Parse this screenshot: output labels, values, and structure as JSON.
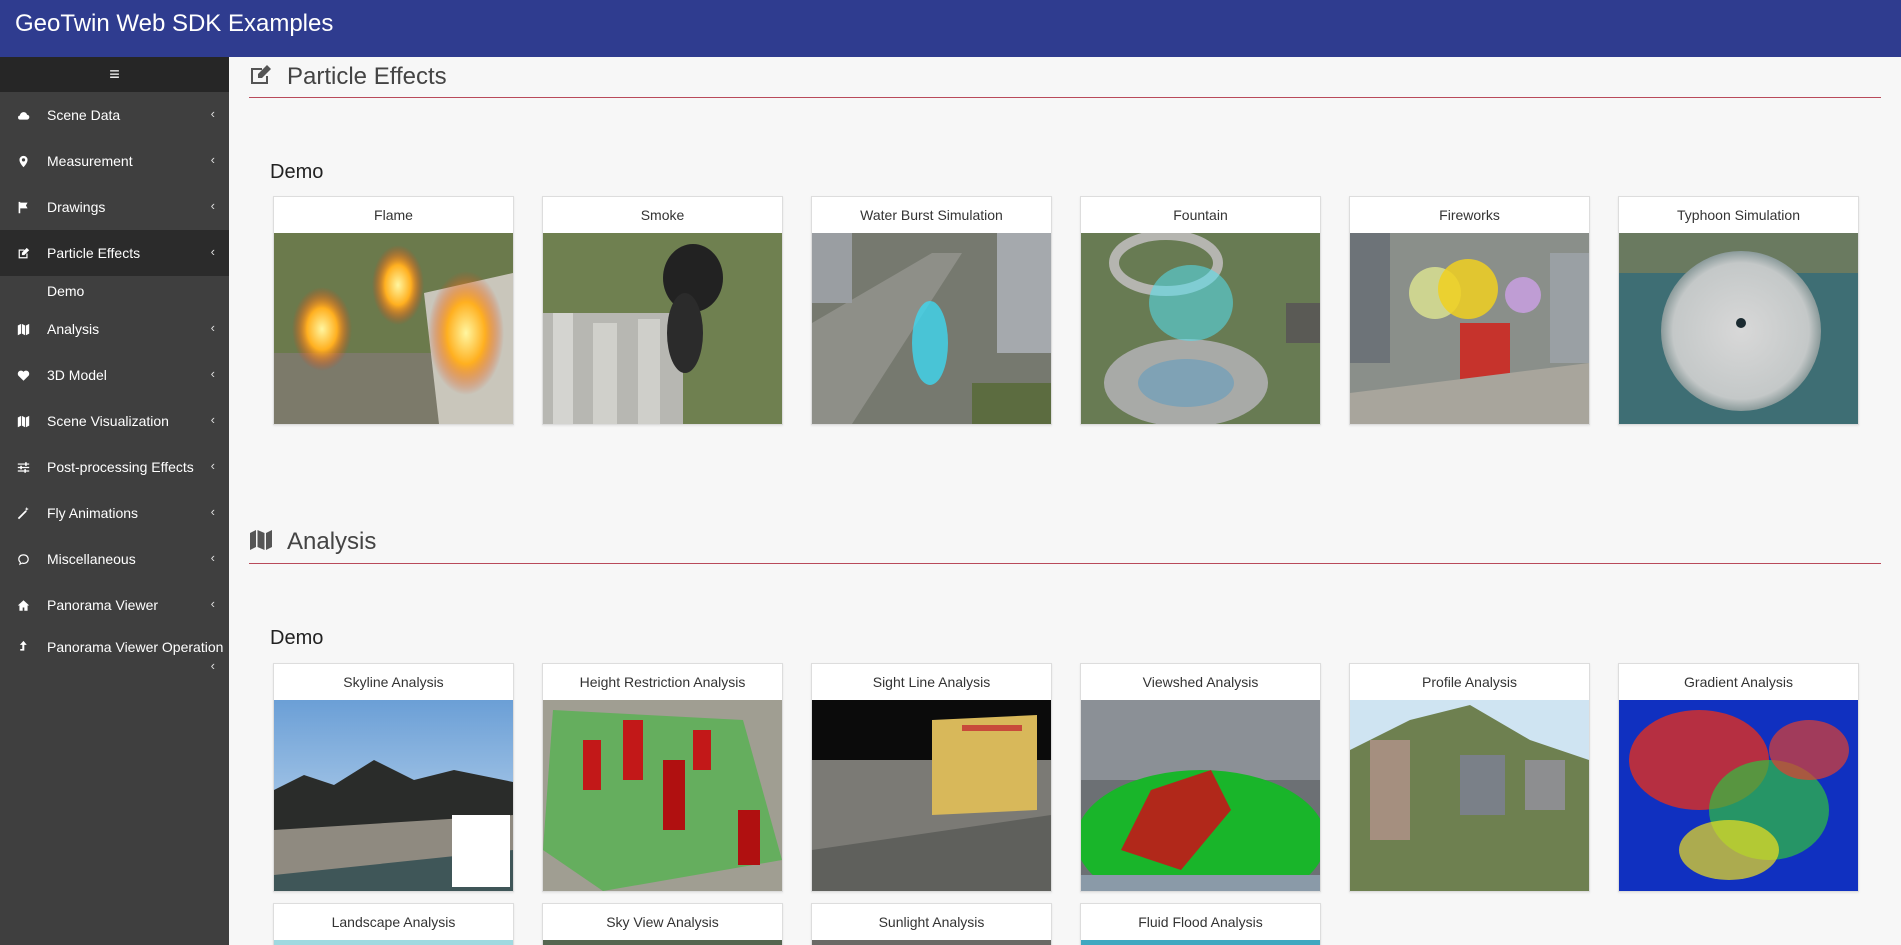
{
  "app": {
    "title": "GeoTwin Web SDK Examples"
  },
  "sidebar": {
    "toggle_icon": "hamburger-icon",
    "items": [
      {
        "label": "Scene Data",
        "icon": "cloud-icon"
      },
      {
        "label": "Measurement",
        "icon": "map-pin-icon"
      },
      {
        "label": "Drawings",
        "icon": "flag-icon"
      },
      {
        "label": "Particle Effects",
        "icon": "edit-icon",
        "active": true,
        "sub": [
          "Demo"
        ]
      },
      {
        "label": "Analysis",
        "icon": "map-icon"
      },
      {
        "label": "3D Model",
        "icon": "heart-icon"
      },
      {
        "label": "Scene Visualization",
        "icon": "map-icon"
      },
      {
        "label": "Post-processing Effects",
        "icon": "sliders-icon"
      },
      {
        "label": "Fly Animations",
        "icon": "magic-wand-icon"
      },
      {
        "label": "Miscellaneous",
        "icon": "comment-icon"
      },
      {
        "label": "Panorama Viewer",
        "icon": "home-icon"
      },
      {
        "label": "Panorama Viewer Operation",
        "icon": "upload-arrow-icon"
      }
    ],
    "chevron": "‹"
  },
  "sections": {
    "particle": {
      "title": "Particle Effects",
      "icon": "edit-icon",
      "demo_label": "Demo",
      "cards": [
        "Flame",
        "Smoke",
        "Water Burst Simulation",
        "Fountain",
        "Fireworks",
        "Typhoon Simulation"
      ]
    },
    "analysis": {
      "title": "Analysis",
      "icon": "map-icon",
      "demo_label": "Demo",
      "cards": [
        "Skyline Analysis",
        "Height Restriction Analysis",
        "Sight Line Analysis",
        "Viewshed Analysis",
        "Profile Analysis",
        "Gradient Analysis",
        "Landscape Analysis",
        "Sky View Analysis",
        "Sunlight Analysis",
        "Fluid Flood Analysis"
      ]
    }
  },
  "colors": {
    "header": "#2f3c8f",
    "sidebar": "#3f3f3f",
    "sidebar_active": "#2b2b2b",
    "section_rule": "#b94a5a"
  }
}
